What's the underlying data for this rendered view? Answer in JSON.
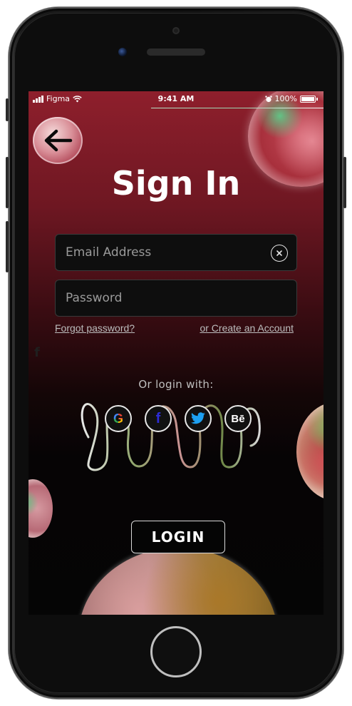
{
  "status_bar": {
    "carrier": "Figma",
    "time": "9:41 AM",
    "battery": "100%"
  },
  "screen": {
    "title": "Sign In",
    "email": {
      "placeholder": "Email Address",
      "value": ""
    },
    "password": {
      "placeholder": "Password",
      "value": ""
    },
    "forgot_password": "Forgot password?",
    "create_account": "or Create an Account",
    "or_login_with": "Or login with:",
    "social": {
      "google": "G",
      "facebook": "f",
      "behance": "Bē"
    },
    "login_button": "LOGIN"
  },
  "colors": {
    "gradient_top": "#8e1f2c",
    "background_bottom": "#050505",
    "text": "#ffffff",
    "facebook": "#2d2dd6",
    "twitter": "#1da1f2"
  }
}
